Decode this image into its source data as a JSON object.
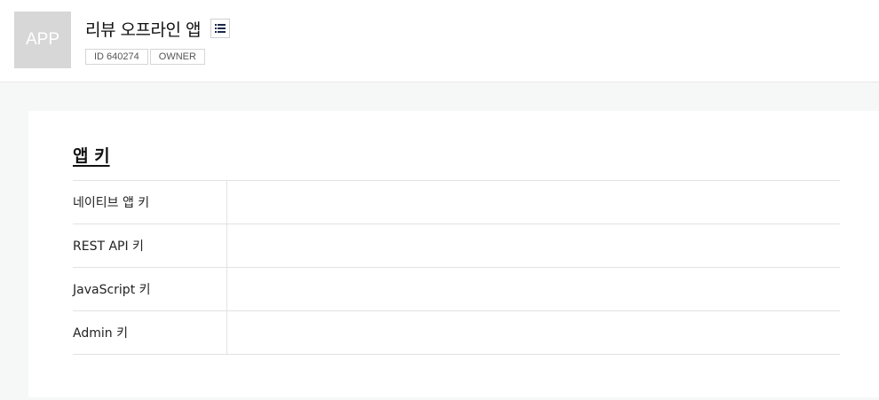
{
  "app": {
    "thumb_text": "APP",
    "title": "리뷰 오프라인 앱",
    "badges": [
      "ID 640274",
      "OWNER"
    ]
  },
  "section": {
    "title": "앱 키"
  },
  "keys": [
    {
      "label": "네이티브 앱 키",
      "value": ""
    },
    {
      "label": "REST API 키",
      "value": ""
    },
    {
      "label": "JavaScript 키",
      "value": ""
    },
    {
      "label": "Admin 키",
      "value": ""
    }
  ],
  "icons": {
    "list_button": "list-icon"
  }
}
